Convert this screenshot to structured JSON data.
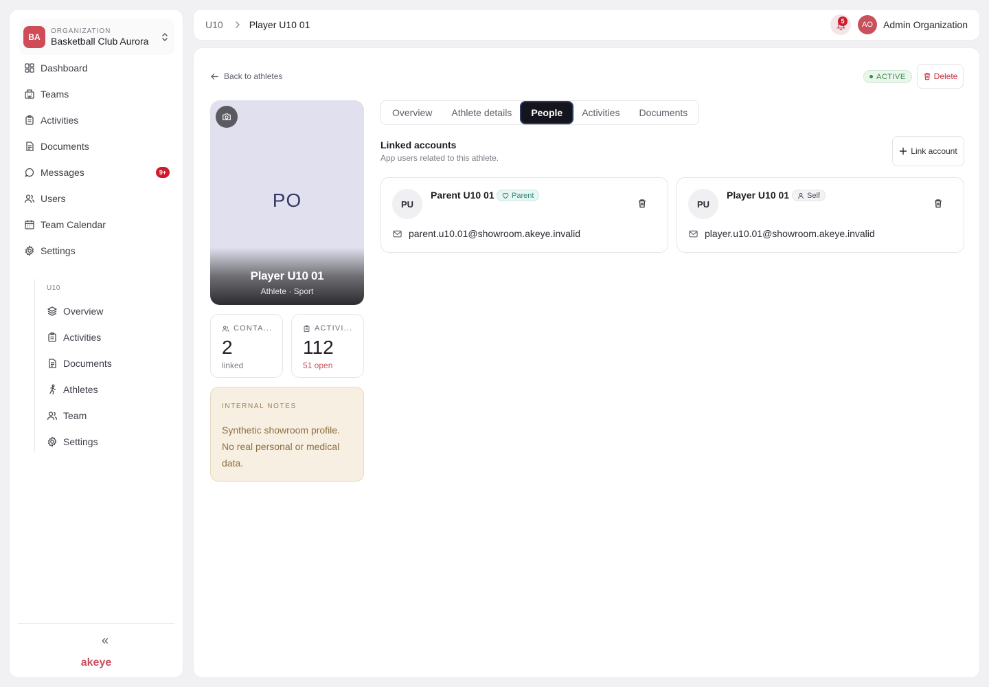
{
  "org": {
    "label": "ORGANIZATION",
    "name": "Basketball Club Aurora",
    "initials": "BA"
  },
  "nav": {
    "items": [
      {
        "label": "Dashboard",
        "icon": "grid-icon"
      },
      {
        "label": "Teams",
        "icon": "building-icon"
      },
      {
        "label": "Activities",
        "icon": "clipboard-icon"
      },
      {
        "label": "Documents",
        "icon": "document-icon"
      },
      {
        "label": "Messages",
        "icon": "chat-icon",
        "badge": "9+"
      },
      {
        "label": "Users",
        "icon": "users-icon"
      },
      {
        "label": "Team Calendar",
        "icon": "calendar-icon"
      },
      {
        "label": "Settings",
        "icon": "gear-icon"
      }
    ],
    "sub_label": "U10",
    "sub_items": [
      {
        "label": "Overview",
        "icon": "layers-icon"
      },
      {
        "label": "Activities",
        "icon": "clipboard-icon"
      },
      {
        "label": "Documents",
        "icon": "document-icon"
      },
      {
        "label": "Athletes",
        "icon": "runner-icon"
      },
      {
        "label": "Team",
        "icon": "users-icon"
      },
      {
        "label": "Settings",
        "icon": "gear-icon"
      }
    ]
  },
  "footer": {
    "collapse": "«",
    "brand": "akeye"
  },
  "topbar": {
    "breadcrumb": [
      "U10",
      "Player U10 01"
    ],
    "notifications": "5",
    "user_initials": "AO",
    "user_name": "Admin Organization"
  },
  "page": {
    "back_label": "Back to athletes",
    "status": "ACTIVE",
    "delete_label": "Delete"
  },
  "profile": {
    "initials": "PO",
    "name": "Player U10 01",
    "subtitle": "Athlete · Sport"
  },
  "stats": [
    {
      "label": "CONTA...",
      "value": "2",
      "sub": "linked",
      "icon": "users-icon"
    },
    {
      "label": "ACTIVI...",
      "value": "112",
      "sub": "51 open",
      "icon": "clipboard-icon"
    }
  ],
  "notes": {
    "title": "INTERNAL NOTES",
    "text": "Synthetic showroom profile. No real personal or medical data."
  },
  "tabs": [
    "Overview",
    "Athlete details",
    "People",
    "Activities",
    "Documents"
  ],
  "active_tab": "People",
  "linked": {
    "title": "Linked accounts",
    "subtitle": "App users related to this athlete.",
    "link_button": "Link account",
    "accounts": [
      {
        "initials": "PU",
        "name": "Parent U10 01",
        "tag": "Parent",
        "email": "parent.u10.01@showroom.akeye.invalid"
      },
      {
        "initials": "PU",
        "name": "Player U10 01",
        "tag": "Self",
        "email": "player.u10.01@showroom.akeye.invalid"
      }
    ]
  },
  "colors": {
    "accent": "#c9505d",
    "badge": "#d11a2a",
    "active_tab": "#14141c",
    "notes_bg": "#f7efe2"
  }
}
